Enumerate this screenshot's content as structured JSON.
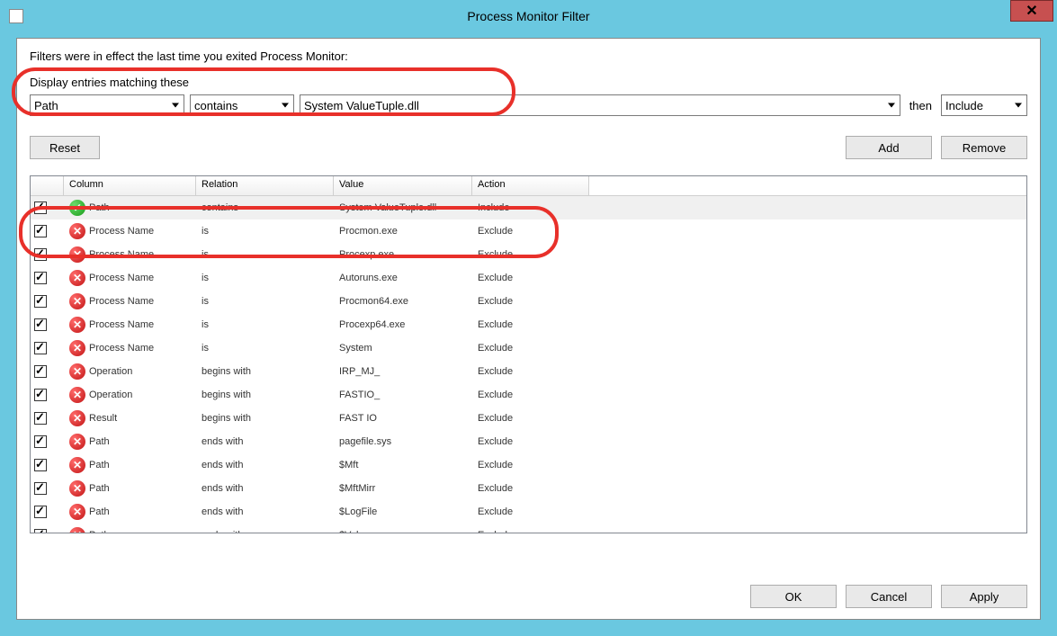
{
  "window": {
    "title": "Process Monitor Filter"
  },
  "info_text": "Filters were in effect the last time you exited Process Monitor:",
  "section_label": "Display entries matching these",
  "filter_row": {
    "column": "Path",
    "relation": "contains",
    "value": "System ValueTuple.dll",
    "then_label": "then",
    "action": "Include"
  },
  "buttons": {
    "reset": "Reset",
    "add": "Add",
    "remove": "Remove",
    "ok": "OK",
    "cancel": "Cancel",
    "apply": "Apply"
  },
  "list": {
    "headers": {
      "column": "Column",
      "relation": "Relation",
      "value": "Value",
      "action": "Action"
    },
    "rows": [
      {
        "checked": true,
        "action_type": "include",
        "column": "Path",
        "relation": "contains",
        "value": "System ValueTuple.dll",
        "action": "Include",
        "selected": true
      },
      {
        "checked": true,
        "action_type": "exclude",
        "column": "Process Name",
        "relation": "is",
        "value": "Procmon.exe",
        "action": "Exclude"
      },
      {
        "checked": true,
        "action_type": "exclude",
        "column": "Process Name",
        "relation": "is",
        "value": "Procexp.exe",
        "action": "Exclude"
      },
      {
        "checked": true,
        "action_type": "exclude",
        "column": "Process Name",
        "relation": "is",
        "value": "Autoruns.exe",
        "action": "Exclude"
      },
      {
        "checked": true,
        "action_type": "exclude",
        "column": "Process Name",
        "relation": "is",
        "value": "Procmon64.exe",
        "action": "Exclude"
      },
      {
        "checked": true,
        "action_type": "exclude",
        "column": "Process Name",
        "relation": "is",
        "value": "Procexp64.exe",
        "action": "Exclude"
      },
      {
        "checked": true,
        "action_type": "exclude",
        "column": "Process Name",
        "relation": "is",
        "value": "System",
        "action": "Exclude"
      },
      {
        "checked": true,
        "action_type": "exclude",
        "column": "Operation",
        "relation": "begins with",
        "value": "IRP_MJ_",
        "action": "Exclude"
      },
      {
        "checked": true,
        "action_type": "exclude",
        "column": "Operation",
        "relation": "begins with",
        "value": "FASTIO_",
        "action": "Exclude"
      },
      {
        "checked": true,
        "action_type": "exclude",
        "column": "Result",
        "relation": "begins with",
        "value": "FAST IO",
        "action": "Exclude"
      },
      {
        "checked": true,
        "action_type": "exclude",
        "column": "Path",
        "relation": "ends with",
        "value": "pagefile.sys",
        "action": "Exclude"
      },
      {
        "checked": true,
        "action_type": "exclude",
        "column": "Path",
        "relation": "ends with",
        "value": "$Mft",
        "action": "Exclude"
      },
      {
        "checked": true,
        "action_type": "exclude",
        "column": "Path",
        "relation": "ends with",
        "value": "$MftMirr",
        "action": "Exclude"
      },
      {
        "checked": true,
        "action_type": "exclude",
        "column": "Path",
        "relation": "ends with",
        "value": "$LogFile",
        "action": "Exclude"
      },
      {
        "checked": true,
        "action_type": "exclude",
        "column": "Path",
        "relation": "ends with",
        "value": "$Volume",
        "action": "Exclude"
      }
    ]
  }
}
